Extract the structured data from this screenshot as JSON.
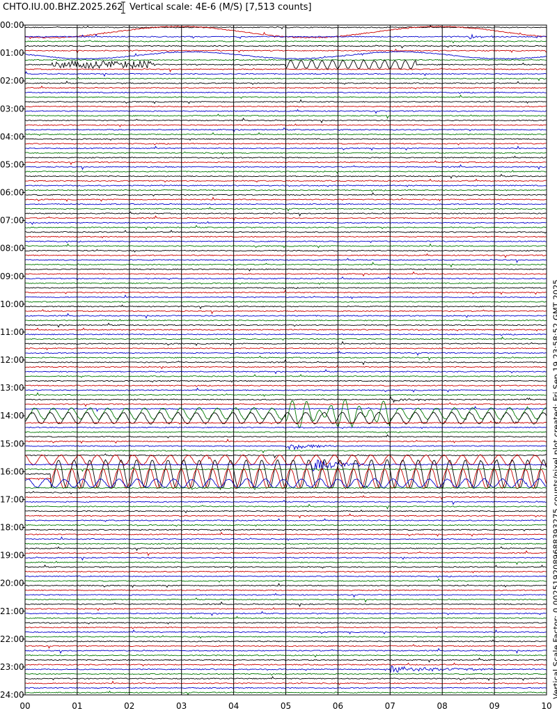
{
  "header": {
    "station": "CHTO.IU.00.BHZ.2025.262",
    "vertical_scale": "Vertical scale: 4E-6 (M/S) [7,513 counts]"
  },
  "side_note": "Vertical Scale Factor: 0.0025192089688393275 counts/pixel plot created: Fri Sep 19 23:58:52 GMT 2025",
  "colors": {
    "trace_cycle": [
      "#000000",
      "#cc0000",
      "#0000cc",
      "#007700"
    ],
    "grid": "#000000"
  },
  "chart_data": {
    "type": "line",
    "title": "CHTO.IU.00.BHZ.2025.262",
    "xlabel": "",
    "ylabel": "",
    "x_ticks": [
      "00",
      "01",
      "02",
      "03",
      "04",
      "05",
      "06",
      "07",
      "08",
      "09",
      "10"
    ],
    "xlim": [
      0,
      10
    ],
    "y_ticks": [
      "00:00",
      "01:00",
      "02:00",
      "03:00",
      "04:00",
      "05:00",
      "06:00",
      "07:00",
      "08:00",
      "09:00",
      "10:00",
      "11:00",
      "12:00",
      "13:00",
      "14:00",
      "15:00",
      "16:00",
      "17:00",
      "18:00",
      "19:00",
      "20:00",
      "21:00",
      "22:00",
      "23:00",
      "24:00"
    ],
    "traces_per_hour": 6,
    "grid": true,
    "events": [
      {
        "row": 1,
        "x_start": 0.0,
        "x_end": 10.0,
        "period": 5.0,
        "amp": 8,
        "type": "long-period"
      },
      {
        "row": 2,
        "x_start": 8.5,
        "x_end": 9.3,
        "period": 0.1,
        "amp": 4,
        "type": "burst"
      },
      {
        "row": 6,
        "x_start": 0.0,
        "x_end": 10.0,
        "period": 4.0,
        "amp": 5,
        "type": "long-period"
      },
      {
        "row": 8,
        "x_start": 0.5,
        "x_end": 2.5,
        "period": 0.08,
        "amp": 5,
        "type": "noise"
      },
      {
        "row": 8,
        "x_start": 5.0,
        "x_end": 7.5,
        "period": 0.2,
        "amp": 6,
        "type": "wave"
      },
      {
        "row": 80,
        "x_start": 7.0,
        "x_end": 8.0,
        "period": 0.1,
        "amp": 5,
        "type": "burst"
      },
      {
        "row": 83,
        "x_start": 0.0,
        "x_end": 10.0,
        "period": 0.35,
        "amp": 8,
        "type": "wave"
      },
      {
        "row": 83,
        "x_start": 5.0,
        "x_end": 7.0,
        "period": 0.25,
        "amp": 12,
        "type": "wave"
      },
      {
        "row": 84,
        "x_start": 0.0,
        "x_end": 10.0,
        "period": 0.35,
        "amp": 8,
        "type": "wave"
      },
      {
        "row": 90,
        "x_start": 5.0,
        "x_end": 6.5,
        "period": 0.05,
        "amp": 6,
        "type": "burst"
      },
      {
        "row": 93,
        "x_start": 0.0,
        "x_end": 10.0,
        "period": 0.35,
        "amp": 7,
        "type": "wave"
      },
      {
        "row": 94,
        "x_start": 5.5,
        "x_end": 7.0,
        "period": 0.08,
        "amp": 10,
        "type": "burst"
      },
      {
        "row": 96,
        "x_start": 0.5,
        "x_end": 10.0,
        "period": 0.3,
        "amp": 20,
        "type": "wave"
      },
      {
        "row": 97,
        "x_start": 0.5,
        "x_end": 10.0,
        "period": 0.3,
        "amp": 14,
        "type": "wave"
      },
      {
        "row": 98,
        "x_start": 0.0,
        "x_end": 10.0,
        "period": 0.35,
        "amp": 6,
        "type": "wave"
      },
      {
        "row": 138,
        "x_start": 7.0,
        "x_end": 10.0,
        "period": 0.05,
        "amp": 5,
        "type": "burst"
      }
    ]
  }
}
